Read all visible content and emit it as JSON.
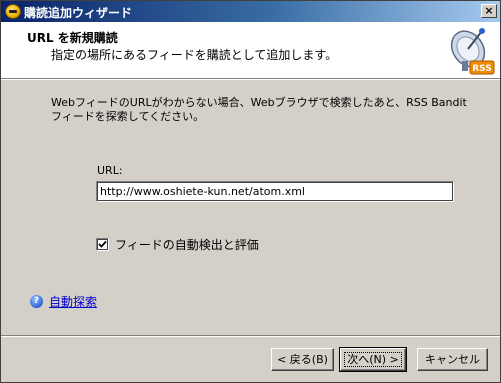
{
  "window": {
    "title": "購読追加ウィザード",
    "close_glyph": "×"
  },
  "header": {
    "title": "URL を新規購読",
    "subtitle": "指定の場所にあるフィードを購読として追加します。",
    "icon_badge": "RSS"
  },
  "body": {
    "description": "WebフィードのURLがわからない場合、Webブラウザで検索したあと、RSS Bandit フィードを探索してください。",
    "url_label": "URL:",
    "url_value": "http://www.oshiete-kun.net/atom.xml",
    "autodetect_label": "フィードの自動検出と評価",
    "autodetect_checked": true,
    "help_icon_glyph": "?",
    "help_link": "自動探索"
  },
  "buttons": {
    "back": "< 戻る(B)",
    "next": "次へ(N) >",
    "cancel": "キャンセル"
  },
  "colors": {
    "titlebar_start": "#0a246a",
    "titlebar_end": "#a6caf0",
    "dialog_bg": "#d4d0c8",
    "link": "#0000cc"
  }
}
